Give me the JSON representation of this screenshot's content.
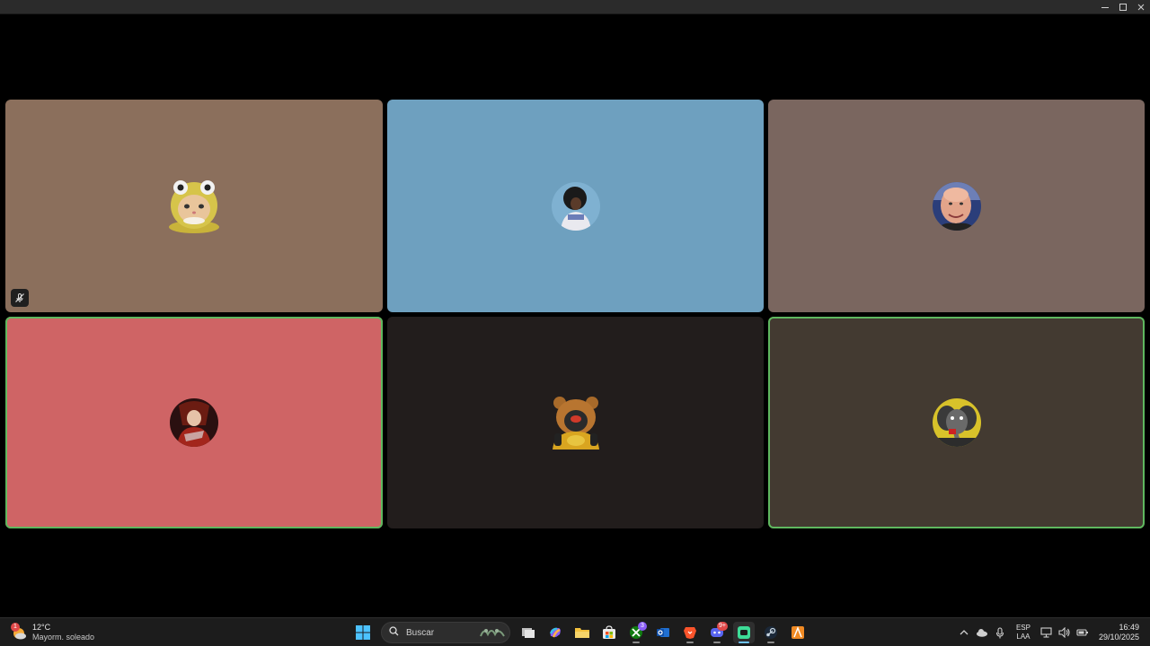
{
  "window": {
    "controls": [
      "minimize-icon",
      "maximize-icon",
      "close-icon"
    ]
  },
  "call": {
    "participants": [
      {
        "avatar": "frog-hat-cat-avatar",
        "tile_color": "#8B6F5C",
        "muted": true,
        "speaking": false
      },
      {
        "avatar": "afro-person-avatar",
        "tile_color": "#6EA0BF",
        "muted": false,
        "speaking": false
      },
      {
        "avatar": "bald-man-avatar",
        "tile_color": "#7A665F",
        "muted": false,
        "speaking": false
      },
      {
        "avatar": "red-warrior-avatar",
        "tile_color": "#CF6465",
        "muted": false,
        "speaking": true
      },
      {
        "avatar": "armored-bear-avatar",
        "tile_color": "#221D1C",
        "muted": false,
        "speaking": false
      },
      {
        "avatar": "cartoon-elephant-avatar",
        "tile_color": "#433A31",
        "muted": false,
        "speaking": true
      }
    ]
  },
  "taskbar": {
    "weather": {
      "temp": "12°C",
      "desc": "Mayorm. soleado",
      "alert_count": "1"
    },
    "search": {
      "placeholder": "Buscar"
    },
    "apps": [
      {
        "icon": "windows-start-icon"
      },
      {
        "icon": "task-view-icon"
      },
      {
        "icon": "copilot-icon"
      },
      {
        "icon": "file-explorer-icon"
      },
      {
        "icon": "microsoft-store-icon"
      },
      {
        "icon": "xbox-icon",
        "badge": "3"
      },
      {
        "icon": "outlook-icon"
      },
      {
        "icon": "brave-icon"
      },
      {
        "icon": "discord-icon",
        "badge": "9+"
      },
      {
        "icon": "chat-app-icon",
        "active": true
      },
      {
        "icon": "steam-icon"
      },
      {
        "icon": "affinity-icon"
      }
    ],
    "tray": {
      "lang_top": "ESP",
      "lang_bottom": "LAA",
      "time": "16:49",
      "date": "29/10/2025"
    }
  }
}
